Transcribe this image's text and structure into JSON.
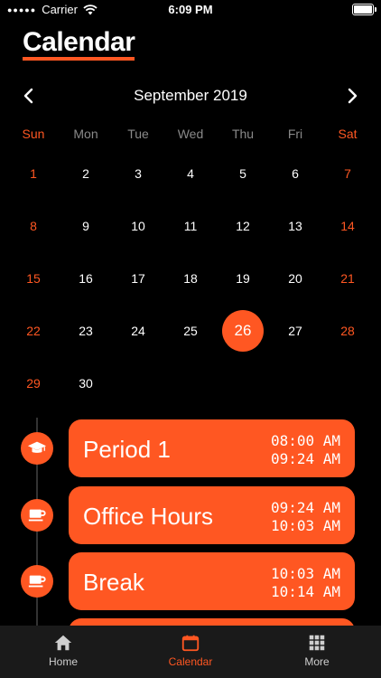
{
  "status": {
    "carrier": "Carrier",
    "time": "6:09 PM"
  },
  "header": {
    "title": "Calendar"
  },
  "calendar": {
    "month_label": "September 2019",
    "weekdays": [
      "Sun",
      "Mon",
      "Tue",
      "Wed",
      "Thu",
      "Fri",
      "Sat"
    ],
    "days": [
      1,
      2,
      3,
      4,
      5,
      6,
      7,
      8,
      9,
      10,
      11,
      12,
      13,
      14,
      15,
      16,
      17,
      18,
      19,
      20,
      21,
      22,
      23,
      24,
      25,
      26,
      27,
      28,
      29,
      30
    ],
    "selected_day": 26,
    "first_weekday_index": 0
  },
  "events": [
    {
      "name": "Period 1",
      "start": "08:00 AM",
      "end": "09:24 AM",
      "icon": "graduation-cap-icon"
    },
    {
      "name": "Office Hours",
      "start": "09:24 AM",
      "end": "10:03 AM",
      "icon": "coffee-cup-icon"
    },
    {
      "name": "Break",
      "start": "10:03 AM",
      "end": "10:14 AM",
      "icon": "coffee-cup-icon"
    }
  ],
  "tabs": [
    {
      "label": "Home",
      "icon": "home-icon"
    },
    {
      "label": "Calendar",
      "icon": "calendar-icon"
    },
    {
      "label": "More",
      "icon": "grid-icon"
    }
  ],
  "colors": {
    "accent": "#ff5722",
    "background": "#000000",
    "tabbar": "#1a1a1a"
  }
}
